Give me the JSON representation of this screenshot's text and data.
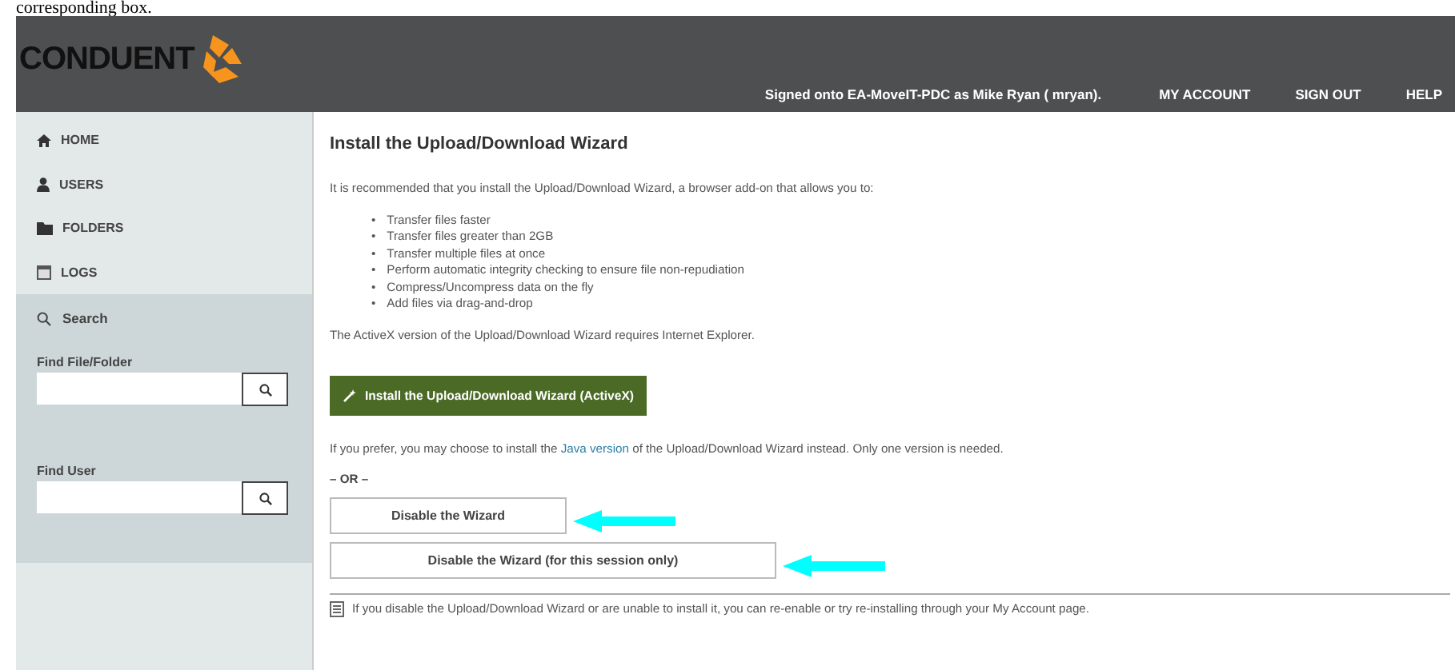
{
  "document_caption": "corresponding box.",
  "header": {
    "logo": "CONDUENT",
    "signed_in": "Signed onto EA-MoveIT-PDC as Mike Ryan ( mryan).",
    "links": [
      "MY ACCOUNT",
      "SIGN OUT",
      "HELP"
    ]
  },
  "sidebar": {
    "items": [
      {
        "label": "HOME",
        "kind": "home"
      },
      {
        "label": "USERS",
        "kind": "users"
      },
      {
        "label": "FOLDERS",
        "kind": "folders"
      },
      {
        "label": "LOGS",
        "kind": "logs"
      }
    ],
    "search": {
      "title": "Search",
      "fields": [
        {
          "label": "Find File/Folder"
        },
        {
          "label": "Find User"
        }
      ]
    }
  },
  "content": {
    "title": "Install the Upload/Download Wizard",
    "intro": "It is recommended that you install the Upload/Download Wizard, a browser add-on that allows you to:",
    "features": [
      {
        "marker": "•",
        "text": "Transfer files faster"
      },
      {
        "marker": "•",
        "text": "Transfer files greater than 2GB"
      },
      {
        "marker": "•",
        "text": "Transfer multiple files at once"
      },
      {
        "marker": "•",
        "text": "Perform automatic integrity checking to ensure file non-repudiation"
      },
      {
        "marker": "•",
        "text": "Compress/Uncompress data on the fly"
      },
      {
        "marker": "•",
        "text": "Add files via drag-and-drop"
      }
    ],
    "activex_note": "The ActiveX version of the Upload/Download Wizard requires Internet Explorer.",
    "install_button": "Install the Upload/Download Wizard (ActiveX)",
    "java_note": {
      "before": "If you prefer, you may choose to install the ",
      "link": "Java version",
      "after": " of the Upload/Download Wizard instead. Only one version is needed."
    },
    "or": "– OR –",
    "disable_buttons": [
      "Disable the Wizard",
      "Disable the Wizard (for this session only)"
    ],
    "footer_note": "If you disable the Upload/Download Wizard or are unable to install it, you can re-enable or try re-installing through your My Account page."
  }
}
